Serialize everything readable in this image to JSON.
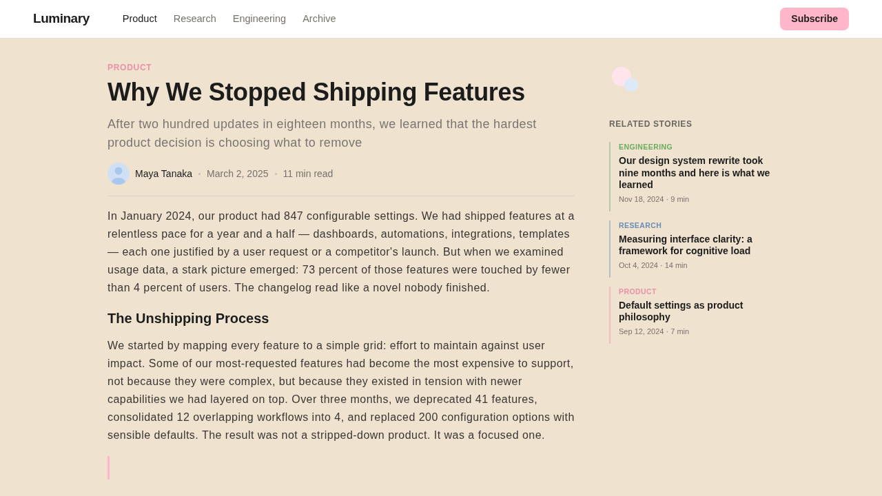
{
  "header": {
    "logo": "Luminary",
    "nav": [
      {
        "label": "Product",
        "selected": true
      },
      {
        "label": "Research",
        "selected": false
      },
      {
        "label": "Engineering",
        "selected": false
      },
      {
        "label": "Archive",
        "selected": false
      }
    ],
    "subscribe": "Subscribe"
  },
  "article": {
    "category": "PRODUCT",
    "title": "Why We Stopped Shipping Features",
    "subtitle": "After two hundred updates in eighteen months, we learned that the hardest product decision is choosing what to remove",
    "author": "Maya Tanaka",
    "date": "March 2, 2025",
    "read_time": "11 min read",
    "body": [
      {
        "kind": "paragraph",
        "text": "In January 2024, our product had 847 configurable settings. We had shipped features at a relentless pace for a year and a half — dashboards, automations, integrations, templates — each one justified by a user request or a competitor's launch. But when we examined usage data, a stark picture emerged: 73 percent of those features were touched by fewer than 4 percent of users. The changelog read like a novel nobody finished."
      },
      {
        "kind": "heading",
        "text": "The Unshipping Process"
      },
      {
        "kind": "paragraph",
        "text": "We started by mapping every feature to a simple grid: effort to maintain against user impact. Some of our most-requested features had become the most expensive to support, not because they were complex, but because they existed in tension with newer capabilities we had layered on top. Over three months, we deprecated 41 features, consolidated 12 overlapping workflows into 4, and replaced 200 configuration options with sensible defaults. The result was not a stripped-down product. It was a focused one."
      },
      {
        "kind": "quote"
      }
    ]
  },
  "related": {
    "heading": "RELATED STORIES",
    "items": [
      {
        "category": "ENGINEERING",
        "color": "#6aab5e",
        "title": "Our design system rewrite took nine months and here is what we learned",
        "meta": "Nov 18, 2024 · 9 min"
      },
      {
        "category": "RESEARCH",
        "color": "#6b8cb5",
        "title": "Measuring interface clarity: a framework for cognitive load",
        "meta": "Oct 4, 2024 · 14 min"
      },
      {
        "category": "PRODUCT",
        "color": "#e891a8",
        "title": "Default settings as product philosophy",
        "meta": "Sep 12, 2024 · 7 min"
      }
    ]
  }
}
